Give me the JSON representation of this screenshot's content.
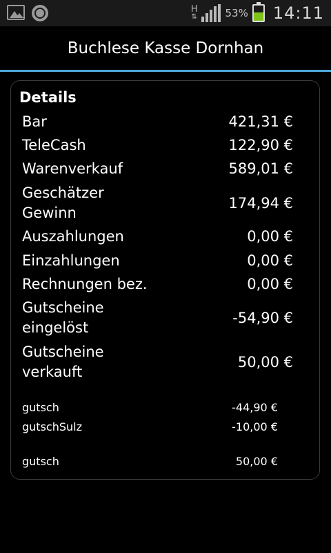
{
  "status": {
    "signal_type": "H",
    "battery_percent": "53%",
    "time": "14:11"
  },
  "header": {
    "title": "Buchlese Kasse Dornhan"
  },
  "details": {
    "heading": "Details",
    "rows": [
      {
        "label": "Bar",
        "value": "421,31 €"
      },
      {
        "label": "TeleCash",
        "value": "122,90 €"
      },
      {
        "label": "Warenverkauf",
        "value": "589,01 €"
      },
      {
        "label": "Geschätzer\nGewinn",
        "value": "174,94 €"
      },
      {
        "label": "Auszahlungen",
        "value": "0,00 €"
      },
      {
        "label": "Einzahlungen",
        "value": "0,00 €"
      },
      {
        "label": "Rechnungen bez.",
        "value": "0,00 €"
      },
      {
        "label": "Gutscheine\neingelöst",
        "value": "-54,90 €"
      },
      {
        "label": "Gutscheine\nverkauft",
        "value": "50,00 €"
      }
    ],
    "redeemed_items": [
      {
        "name": "gutsch",
        "value": "-44,90 €"
      },
      {
        "name": "gutschSulz",
        "value": "-10,00 €"
      }
    ],
    "sold_items": [
      {
        "name": "gutsch",
        "value": "50,00 €"
      }
    ]
  }
}
